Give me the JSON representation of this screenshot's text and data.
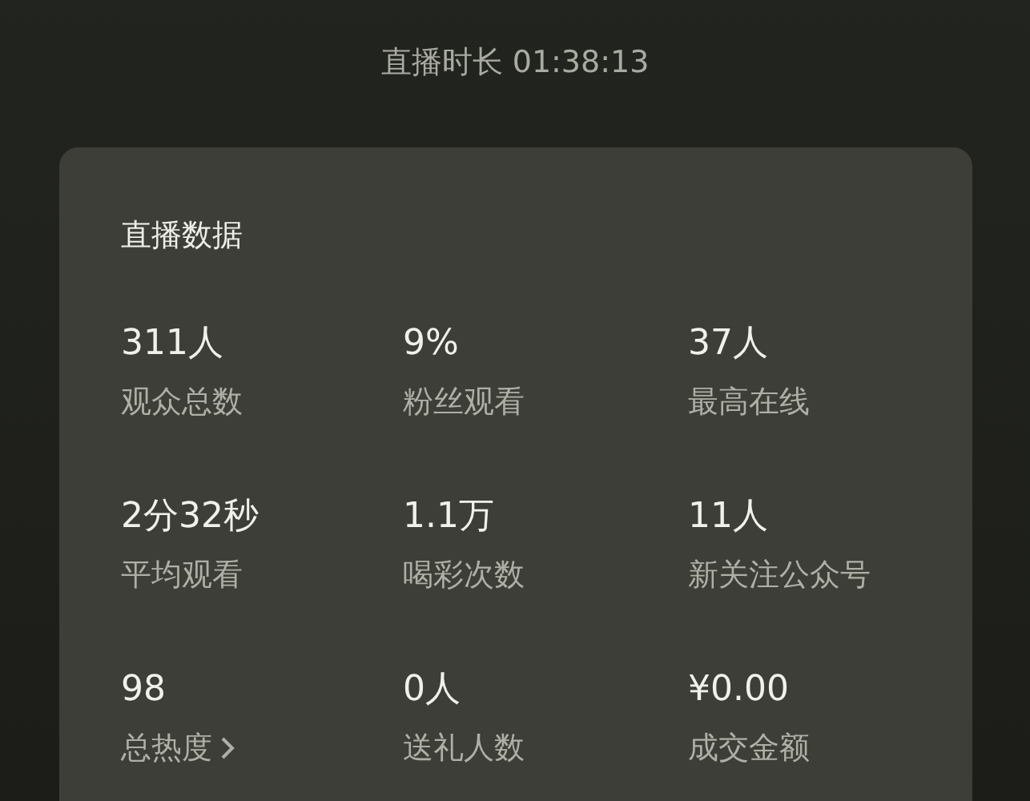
{
  "header": {
    "title": "直播时长 01:38:13"
  },
  "card": {
    "title": "直播数据",
    "stats": [
      {
        "value": "311人",
        "label": "观众总数"
      },
      {
        "value": "9%",
        "label": "粉丝观看"
      },
      {
        "value": "37人",
        "label": "最高在线"
      },
      {
        "value": "2分32秒",
        "label": "平均观看"
      },
      {
        "value": "1.1万",
        "label": "喝彩次数"
      },
      {
        "value": "11人",
        "label": "新关注公众号"
      },
      {
        "value": "98",
        "label": "总热度",
        "link": true
      },
      {
        "value": "0人",
        "label": "送礼人数"
      },
      {
        "value": "¥0.00",
        "label": "成交金额"
      }
    ]
  }
}
